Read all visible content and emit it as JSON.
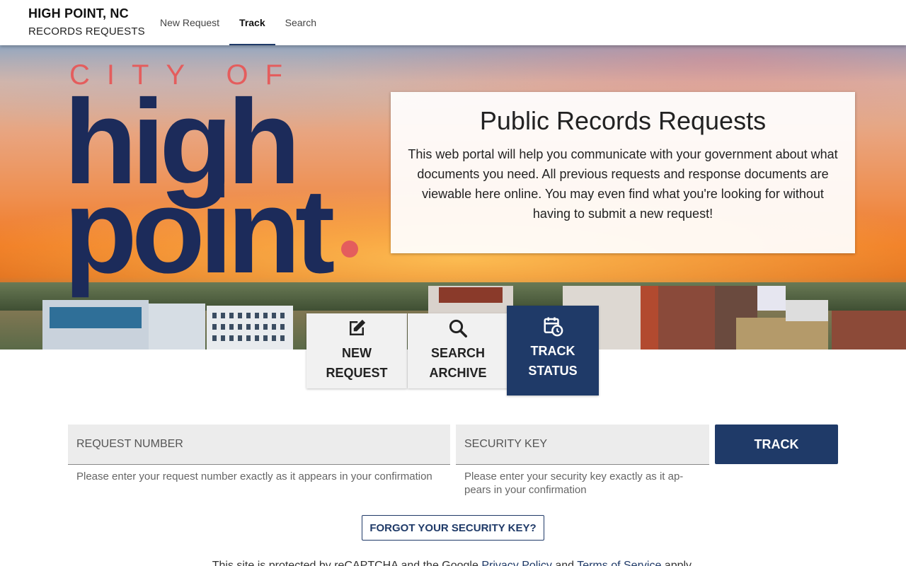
{
  "header": {
    "brand_city": "HIGH POINT, NC",
    "brand_sub": "RECORDS REQUESTS",
    "tabs": [
      {
        "label": "New Request",
        "active": false
      },
      {
        "label": "Track",
        "active": true
      },
      {
        "label": "Search",
        "active": false
      }
    ]
  },
  "hero": {
    "logo_city_of": "CITY OF",
    "logo_high": "high",
    "logo_point": "point",
    "card_title": "Public Records Requests",
    "card_body": "This web portal will help you communicate with your government about what documents you need. All previous requests and response documents are viewable here online. You may even find what you're looking for without having to submit a new request!"
  },
  "tiles": [
    {
      "line1": "NEW",
      "line2": "REQUEST",
      "icon": "edit-icon",
      "active": false
    },
    {
      "line1": "SEARCH",
      "line2": "ARCHIVE",
      "icon": "search-icon",
      "active": false
    },
    {
      "line1": "TRACK",
      "line2": "STATUS",
      "icon": "calendar-clock-icon",
      "active": true
    }
  ],
  "form": {
    "request_number_placeholder": "REQUEST NUMBER",
    "request_number_hint": "Please enter your request number exactly as it appears in your confirmation",
    "security_key_placeholder": "SECURITY KEY",
    "security_key_hint": "Please enter your security key exactly as it ap-pears in your confirmation",
    "track_label": "TRACK",
    "forgot_label": "FORGOT YOUR SECURITY KEY?"
  },
  "footer": {
    "prefix": "This site is protected by reCAPTCHA and the Google ",
    "privacy": "Privacy Policy",
    "and": " and ",
    "terms": "Terms of Service",
    "suffix": " apply."
  },
  "colors": {
    "primary": "#1f3a68",
    "logo_navy": "#1c2b5a",
    "logo_coral": "#e45d5d"
  }
}
